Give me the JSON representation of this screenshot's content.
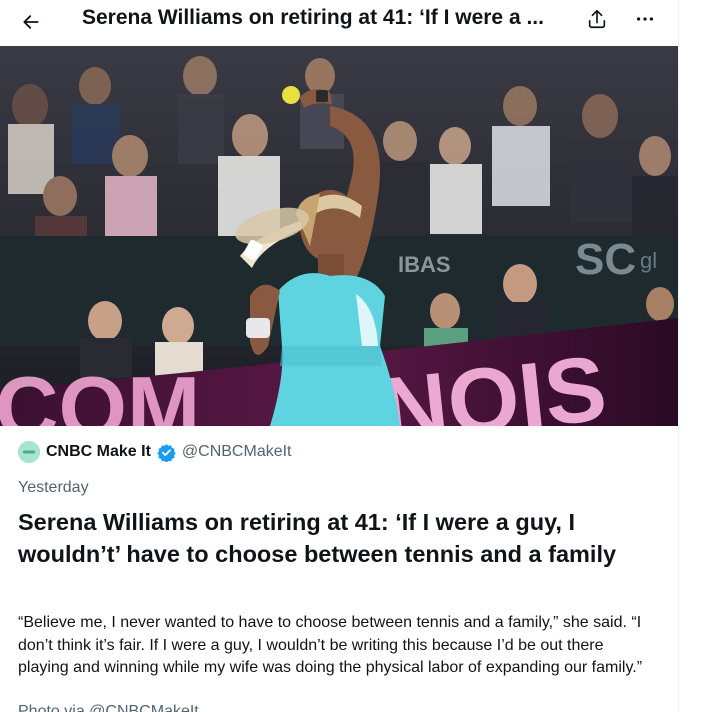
{
  "header": {
    "title": "Serena Williams on retiring at 41: ‘If I were a ...",
    "back_icon": "arrow-left-icon",
    "share_icon": "share-icon",
    "more_icon": "more-horizontal-icon"
  },
  "media": {
    "banner_text_left": "SC",
    "banner_text_right": "gl",
    "board_text": "IBAS",
    "stage_text_left": "COM",
    "stage_text_right": "NOIS"
  },
  "card": {
    "source_name": "CNBC Make It",
    "verified_icon": "verified-badge-icon",
    "handle": "@CNBCMakeIt",
    "date": "Yesterday",
    "headline": "Serena Williams on retiring at 41: ‘If I were a guy, I wouldn’t’ have to choose between tennis and a family",
    "body": "“Believe me, I never wanted to have to choose between tennis and a family,” she said. “I don’t think it’s fair. If I were a guy, I wouldn’t be writing this because I’d be out there playing and winning while my wife was doing the physical labor of expanding our family.”",
    "credit": "Photo via @CNBCMakeIt"
  },
  "colors": {
    "text": "#0f1419",
    "muted": "#536471",
    "verified": "#1d9bf0",
    "dress": "#5fd3df",
    "stage": "#f0a4d0"
  }
}
